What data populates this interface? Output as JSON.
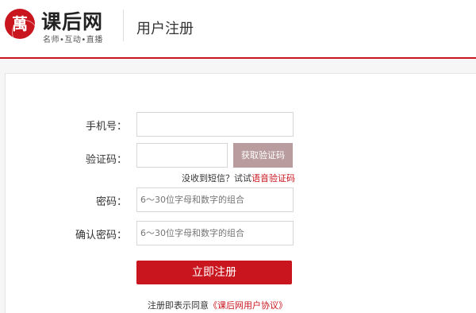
{
  "header": {
    "logo_text": "萬",
    "site_name": "课后网",
    "slogan": "名师•互动•直播",
    "page_title": "用户注册"
  },
  "form": {
    "phone_label": "手机号：",
    "phone_value": "",
    "code_label": "验证码：",
    "code_value": "",
    "get_code_button": "获取验证码",
    "no_sms_text": "没收到短信？试试",
    "voice_code_link": "语音验证码",
    "password_label": "密码：",
    "password_placeholder": "6～30位字母和数字的组合",
    "confirm_label": "确认密码：",
    "confirm_placeholder": "6～30位字母和数字的组合",
    "submit_button": "立即注册",
    "agree_text": "注册即表示同意",
    "agreement_link": "《课后网用户协议》"
  },
  "colors": {
    "brand": "#c9161e",
    "code_button": "#b89c9e"
  }
}
